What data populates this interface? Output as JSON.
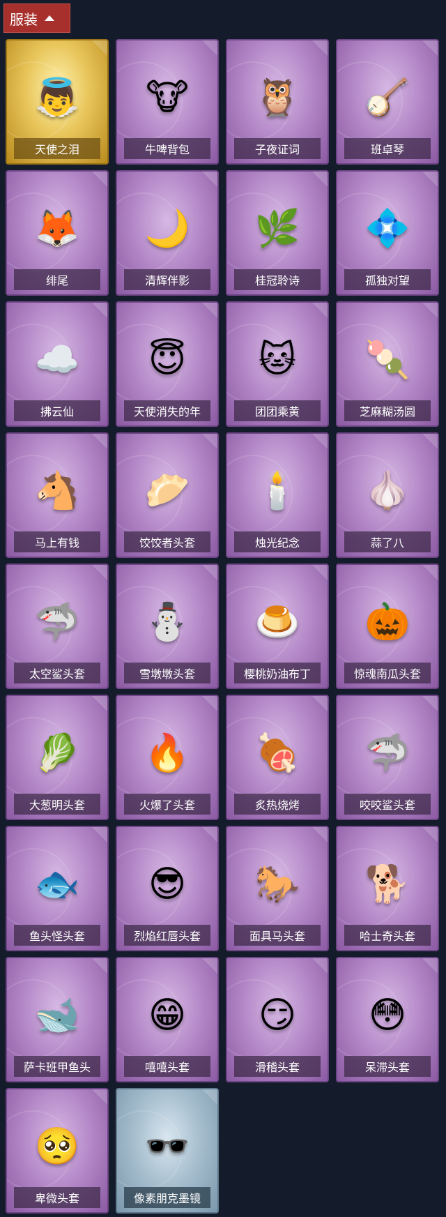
{
  "header": {
    "title": "服装",
    "toggle_icon": "chevron-up-icon"
  },
  "items": [
    {
      "label": "天使之泪",
      "icon": "angel-halo-icon",
      "glyph": "👼",
      "rarity": "gold"
    },
    {
      "label": "牛啤背包",
      "icon": "cow-beer-barrel-icon",
      "glyph": "🐮",
      "rarity": "purple"
    },
    {
      "label": "子夜证词",
      "icon": "owl-doctor-icon",
      "glyph": "🦉",
      "rarity": "purple"
    },
    {
      "label": "班卓琴",
      "icon": "pink-creature-banjo-icon",
      "glyph": "🪕",
      "rarity": "purple"
    },
    {
      "label": "绯尾",
      "icon": "fox-girl-charm-icon",
      "glyph": "🦊",
      "rarity": "purple"
    },
    {
      "label": "清辉伴影",
      "icon": "silver-hair-charm-icon",
      "glyph": "🌙",
      "rarity": "purple"
    },
    {
      "label": "桂冠聆诗",
      "icon": "laurel-poet-charm-icon",
      "glyph": "🌿",
      "rarity": "purple"
    },
    {
      "label": "孤独对望",
      "icon": "blue-hair-charm-icon",
      "glyph": "💠",
      "rarity": "purple"
    },
    {
      "label": "拂云仙",
      "icon": "cloud-fairy-charm-icon",
      "glyph": "☁️",
      "rarity": "purple"
    },
    {
      "label": "天使消失的年",
      "icon": "girl-halo-charm-icon",
      "glyph": "😇",
      "rarity": "purple"
    },
    {
      "label": "团团乘黄",
      "icon": "round-cat-head-icon",
      "glyph": "🐱",
      "rarity": "purple"
    },
    {
      "label": "芝麻糊汤圆",
      "icon": "rice-ball-head-icon",
      "glyph": "🍡",
      "rarity": "purple"
    },
    {
      "label": "马上有钱",
      "icon": "red-horse-head-icon",
      "glyph": "🐴",
      "rarity": "purple"
    },
    {
      "label": "饺饺者头套",
      "icon": "dumpling-head-icon",
      "glyph": "🥟",
      "rarity": "purple"
    },
    {
      "label": "烛光纪念",
      "icon": "candle-head-icon",
      "glyph": "🕯️",
      "rarity": "purple"
    },
    {
      "label": "蒜了八",
      "icon": "garlic-head-icon",
      "glyph": "🧄",
      "rarity": "purple"
    },
    {
      "label": "太空鲨头套",
      "icon": "space-shark-head-icon",
      "glyph": "🦈",
      "rarity": "purple"
    },
    {
      "label": "雪墩墩头套",
      "icon": "snowman-head-icon",
      "glyph": "⛄",
      "rarity": "purple"
    },
    {
      "label": "樱桃奶油布丁",
      "icon": "pudding-head-icon",
      "glyph": "🍮",
      "rarity": "purple"
    },
    {
      "label": "惊魂南瓜头套",
      "icon": "pumpkin-head-icon",
      "glyph": "🎃",
      "rarity": "purple"
    },
    {
      "label": "大葱明头套",
      "icon": "scallion-head-icon",
      "glyph": "🥬",
      "rarity": "purple"
    },
    {
      "label": "火爆了头套",
      "icon": "fire-head-icon",
      "glyph": "🔥",
      "rarity": "purple"
    },
    {
      "label": "炙热烧烤",
      "icon": "meat-bone-head-icon",
      "glyph": "🍖",
      "rarity": "purple"
    },
    {
      "label": "咬咬鲨头套",
      "icon": "biting-shark-head-icon",
      "glyph": "🦈",
      "rarity": "purple"
    },
    {
      "label": "鱼头怪头套",
      "icon": "fish-monster-head-icon",
      "glyph": "🐟",
      "rarity": "purple"
    },
    {
      "label": "烈焰红唇头套",
      "icon": "yellow-mascot-head-icon",
      "glyph": "😎",
      "rarity": "purple"
    },
    {
      "label": "面具马头套",
      "icon": "horse-mask-head-icon",
      "glyph": "🐎",
      "rarity": "purple"
    },
    {
      "label": "哈士奇头套",
      "icon": "husky-head-icon",
      "glyph": "🐕",
      "rarity": "purple"
    },
    {
      "label": "萨卡班甲鱼头",
      "icon": "armored-fish-head-icon",
      "glyph": "🐋",
      "rarity": "purple"
    },
    {
      "label": "嘻嘻头套",
      "icon": "grinning-face-head-icon",
      "glyph": "😁",
      "rarity": "purple"
    },
    {
      "label": "滑稽头套",
      "icon": "smirk-face-head-icon",
      "glyph": "😏",
      "rarity": "purple"
    },
    {
      "label": "呆滞头套",
      "icon": "staring-face-head-icon",
      "glyph": "😳",
      "rarity": "purple"
    },
    {
      "label": "卑微头套",
      "icon": "humble-face-head-icon",
      "glyph": "🥺",
      "rarity": "purple"
    },
    {
      "label": "像素朋克墨镜",
      "icon": "pixel-sunglasses-icon",
      "glyph": "🕶️",
      "rarity": "blue"
    }
  ]
}
